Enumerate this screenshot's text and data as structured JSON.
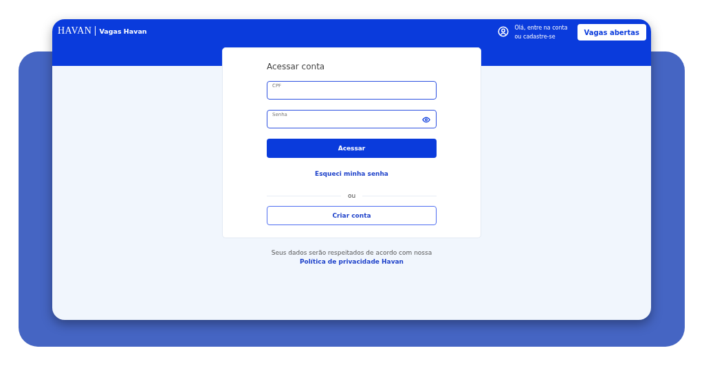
{
  "header": {
    "logo": "HAVAN",
    "site_name": "Vagas Havan",
    "greeting": [
      "Olá, entre na conta",
      "ou cadastre-se"
    ],
    "button": "Vagas abertas"
  },
  "login": {
    "title": "Acessar conta",
    "fields": [
      {
        "label": "CPF",
        "kind": "text"
      },
      {
        "label": "Senha",
        "kind": "password"
      }
    ],
    "submit": "Acessar",
    "forgot": "Esqueci minha senha",
    "separator": "ou",
    "create": "Criar conta"
  },
  "privacy": {
    "text": "Seus dados serão respeitados de acordo com nossa",
    "link": "Política de privacidade Havan"
  }
}
